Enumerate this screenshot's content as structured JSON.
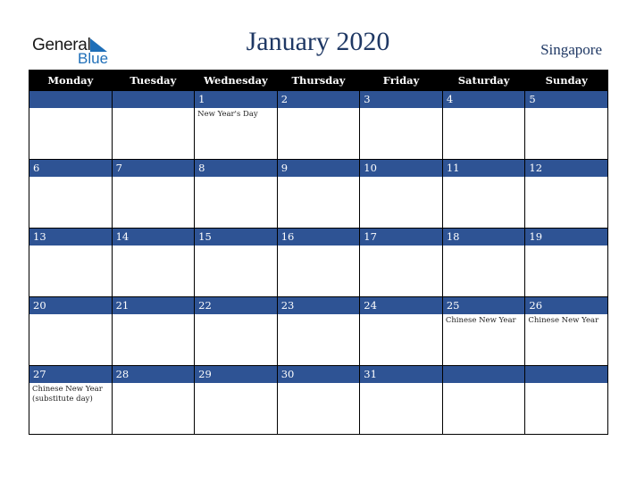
{
  "logo": {
    "word1": "General",
    "word2": "Blue"
  },
  "title": "January 2020",
  "country": "Singapore",
  "colors": {
    "header_bg": "#000000",
    "band_bg": "#2e5394",
    "title": "#1f3864",
    "logo_blue": "#1f6fb8"
  },
  "weekdays": [
    "Monday",
    "Tuesday",
    "Wednesday",
    "Thursday",
    "Friday",
    "Saturday",
    "Sunday"
  ],
  "weeks": [
    [
      {
        "day": "",
        "event": ""
      },
      {
        "day": "",
        "event": ""
      },
      {
        "day": "1",
        "event": "New Year's Day"
      },
      {
        "day": "2",
        "event": ""
      },
      {
        "day": "3",
        "event": ""
      },
      {
        "day": "4",
        "event": ""
      },
      {
        "day": "5",
        "event": ""
      }
    ],
    [
      {
        "day": "6",
        "event": ""
      },
      {
        "day": "7",
        "event": ""
      },
      {
        "day": "8",
        "event": ""
      },
      {
        "day": "9",
        "event": ""
      },
      {
        "day": "10",
        "event": ""
      },
      {
        "day": "11",
        "event": ""
      },
      {
        "day": "12",
        "event": ""
      }
    ],
    [
      {
        "day": "13",
        "event": ""
      },
      {
        "day": "14",
        "event": ""
      },
      {
        "day": "15",
        "event": ""
      },
      {
        "day": "16",
        "event": ""
      },
      {
        "day": "17",
        "event": ""
      },
      {
        "day": "18",
        "event": ""
      },
      {
        "day": "19",
        "event": ""
      }
    ],
    [
      {
        "day": "20",
        "event": ""
      },
      {
        "day": "21",
        "event": ""
      },
      {
        "day": "22",
        "event": ""
      },
      {
        "day": "23",
        "event": ""
      },
      {
        "day": "24",
        "event": ""
      },
      {
        "day": "25",
        "event": "Chinese New Year"
      },
      {
        "day": "26",
        "event": "Chinese New Year"
      }
    ],
    [
      {
        "day": "27",
        "event": "Chinese New Year (substitute day)"
      },
      {
        "day": "28",
        "event": ""
      },
      {
        "day": "29",
        "event": ""
      },
      {
        "day": "30",
        "event": ""
      },
      {
        "day": "31",
        "event": ""
      },
      {
        "day": "",
        "event": ""
      },
      {
        "day": "",
        "event": ""
      }
    ]
  ]
}
